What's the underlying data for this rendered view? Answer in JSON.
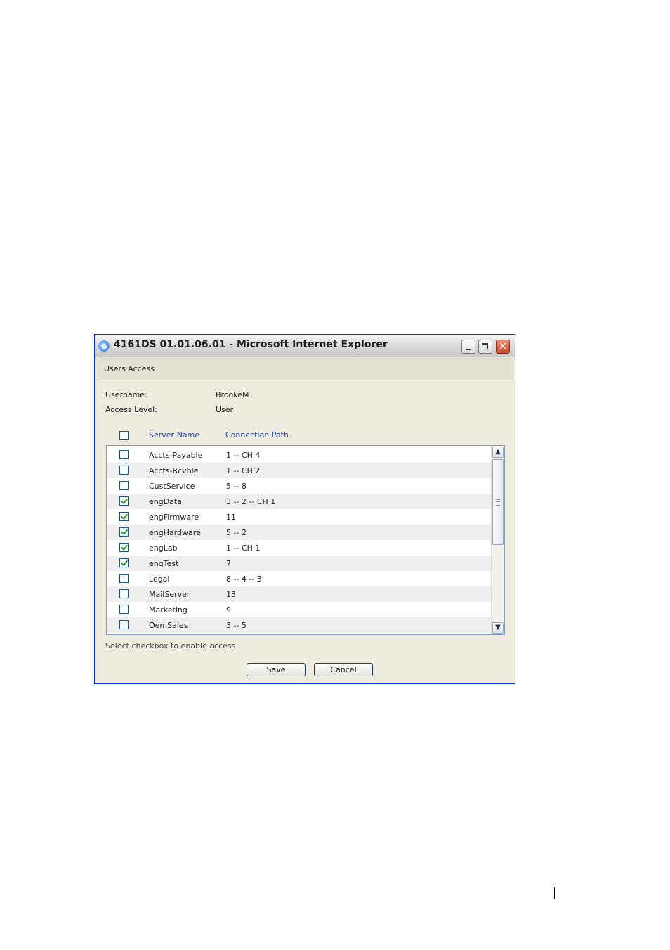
{
  "window": {
    "title": "4161DS 01.01.06.01 - Microsoft Internet Explorer",
    "icon": "internet-explorer-icon",
    "controls": {
      "minimize": "minimize-icon",
      "maximize": "maximize-icon",
      "close": "✕"
    }
  },
  "section": {
    "title": "Users Access"
  },
  "user": {
    "username_label": "Username:",
    "username_value": "BrookeM",
    "access_label": "Access Level:",
    "access_value": "User"
  },
  "table": {
    "headers": {
      "server_name": "Server Name",
      "connection_path": "Connection Path"
    },
    "select_all_checked": false,
    "rows": [
      {
        "name": "Accts-Payable",
        "path": "1 -- CH 4",
        "checked": false
      },
      {
        "name": "Accts-Rcvble",
        "path": "1 -- CH 2",
        "checked": false
      },
      {
        "name": "CustService",
        "path": "5 -- 8",
        "checked": false
      },
      {
        "name": "engData",
        "path": "3 -- 2 -- CH 1",
        "checked": true
      },
      {
        "name": "engFirmware",
        "path": "11",
        "checked": true
      },
      {
        "name": "engHardware",
        "path": "5 -- 2",
        "checked": true
      },
      {
        "name": "engLab",
        "path": "1 -- CH 1",
        "checked": true
      },
      {
        "name": "engTest",
        "path": "7",
        "checked": true
      },
      {
        "name": "Legal",
        "path": "8 -- 4 -- 3",
        "checked": false
      },
      {
        "name": "MailServer",
        "path": "13",
        "checked": false
      },
      {
        "name": "Marketing",
        "path": "9",
        "checked": false
      },
      {
        "name": "OemSales",
        "path": "3 -- 5",
        "checked": false
      }
    ]
  },
  "hint": "Select checkbox to enable access",
  "buttons": {
    "save": "Save",
    "cancel": "Cancel"
  },
  "colors": {
    "window_frame": "#0831d9",
    "dialog_bg": "#eeecdf",
    "header_text": "#1f3f9a",
    "check": "#21a121"
  }
}
